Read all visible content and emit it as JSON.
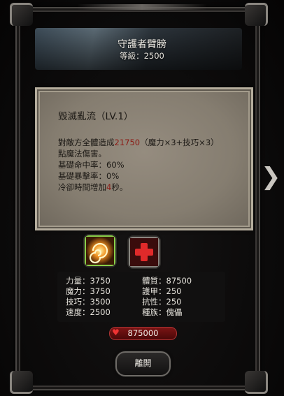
{
  "item": {
    "name": "守護者臂膀",
    "level_label": "等級：2500"
  },
  "skill": {
    "title": "毀滅亂流（LV.1）",
    "desc_prefix": "對敵方全體造成",
    "damage": "21750",
    "desc_suffix": "（魔力×3+技巧×3）",
    "desc_line2": "點魔法傷害。",
    "line_hit": "基礎命中率：60%",
    "line_crit": "基礎暴擊率：0%",
    "cooldown_prefix": "冷卻時間增加",
    "cooldown_value": "4",
    "cooldown_suffix": "秒。"
  },
  "stats": {
    "left": [
      "力量：3750",
      "魔力：3750",
      "技巧：3500",
      "速度：2500"
    ],
    "right": [
      "體質：87500",
      "護甲：250",
      "抗性：250",
      "種族：傀儡"
    ]
  },
  "gold": "875000",
  "close_label": "離開",
  "next_arrow": "❯",
  "icons": {
    "skill1": "swirl-fire-icon",
    "skill2": "red-cross-icon",
    "heart": "heart-icon"
  },
  "colors": {
    "highlight": "#8c1a14",
    "panel": "#8a8275",
    "selected_border": "#8ad04a"
  }
}
